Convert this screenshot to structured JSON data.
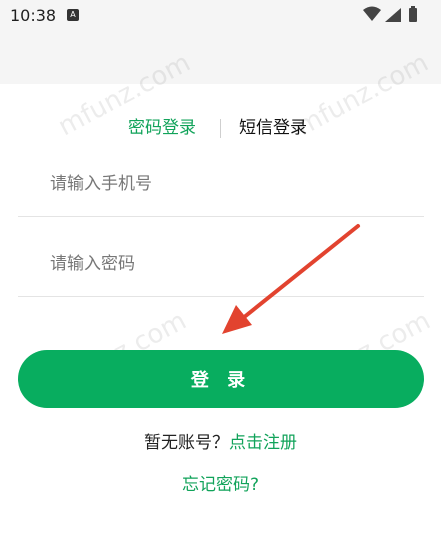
{
  "status_bar": {
    "time": "10:38",
    "icons": [
      "a-icon",
      "wifi-icon",
      "signal-icon",
      "battery-icon"
    ]
  },
  "login_tabs": {
    "password_login": "密码登录",
    "sms_login": "短信登录",
    "active": "password_login"
  },
  "fields": {
    "phone_placeholder": "请输入手机号",
    "password_placeholder": "请输入密码"
  },
  "login_button": "登 录",
  "register": {
    "question": "暂无账号？",
    "link": "点击注册"
  },
  "forgot_password": "忘记密码?",
  "watermark_text": "mfunz.com",
  "colors": {
    "accent_green": "#08ad5f",
    "link_green": "#11a35a",
    "annotation_arrow": "#e2432f"
  }
}
